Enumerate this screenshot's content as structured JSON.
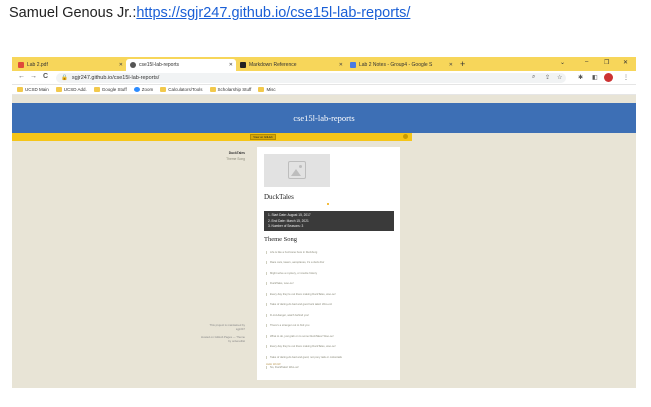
{
  "caption": {
    "prefix": "Samuel Genous Jr.:",
    "link": "https://sgjr247.github.io/cse15l-lab-reports/"
  },
  "browser": {
    "tabs": [
      {
        "label": "Lab 2.pdf",
        "active": false
      },
      {
        "label": "cse15l-lab-reports",
        "active": true
      },
      {
        "label": "Markdown Reference",
        "active": false
      },
      {
        "label": "Lab 2 Notes - Group4 - Google S",
        "active": false
      }
    ],
    "newtab": "+",
    "window_controls": {
      "dropdown": "⌄",
      "minimize": "–",
      "restore": "❐",
      "close": "✕"
    },
    "nav": {
      "back": "←",
      "forward": "→",
      "reload": "C"
    },
    "address": "sgjr247.github.io/cse15l-lab-reports/",
    "bookmarks": [
      "UCSD Main",
      "UCSD Add.",
      "Google Stuff",
      "Zoom",
      "Calculators/Tools",
      "Scholarship Stuff",
      "Misc"
    ]
  },
  "page": {
    "banner_title": "cse15l-lab-reports",
    "github_button": "View on GitHub",
    "side_title": "DuckTales",
    "side_subtitle": "Theme Song",
    "side_footer_1": "This project is maintained by sgjr247",
    "side_footer_2": "Hosted on GitHub Pages — Theme by orderedlist",
    "heading": "DuckTales",
    "dates": [
      "1. Start Date: August 15, 2017",
      "2. End Date: March 15, 2021",
      "3. Number of Seasons: 3"
    ],
    "subheading": "Theme Song",
    "lyrics": [
      "Life is like a hurricane here in Duckburg",
      "Race cars, lasers, aeroplanes, it's a duck-blur",
      "Might solve a mystery, or rewrite history",
      "DuckTales, woo-oo!",
      "Every day they're out there making DuckTales, woo-oo!",
      "Tales of daring-do bad and good luck tales! Woo-oo!",
      "D-d-d-danger, watch behind you!",
      "There's a stranger out to find you",
      "What to do, just grab on to some DuckTales! Woo-oo!",
      "Every day they're out there making DuckTales, woo-oo!",
      "Tales of daring-do bad and good, not pony tails or cottontails",
      "No, DuckTales! Woo-oo!"
    ],
    "trailing": "Hello World!"
  }
}
